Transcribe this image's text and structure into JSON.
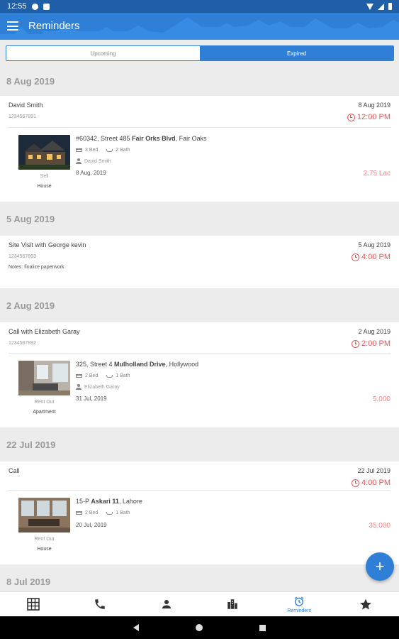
{
  "status_bar": {
    "time": "12:55"
  },
  "app_bar": {
    "title": "Reminders"
  },
  "tabs": [
    {
      "label": "Upcoming",
      "active": false
    },
    {
      "label": "Expired",
      "active": true
    }
  ],
  "groups": [
    {
      "date": "8 Aug 2019",
      "reminder": {
        "title": "David Smith",
        "phone": "1234567891",
        "date": "8 Aug 2019",
        "time": "12:00 PM",
        "property": {
          "address_prefix": "#60342, Street 485 ",
          "address_bold": "Fair Orks Blvd",
          "address_suffix": ", Fair Oaks",
          "beds": "3 Bed",
          "baths": "2 Bath",
          "owner": "David Smith",
          "date": "8 Aug, 2019",
          "price": "2.75 Lac",
          "type": "Sell",
          "category": "House"
        }
      }
    },
    {
      "date": "5 Aug 2019",
      "reminder": {
        "title": "Site Visit with George kevin",
        "phone": "1234567893",
        "notes": "Notes: finalize paperwork",
        "date": "5 Aug 2019",
        "time": "4:00 PM"
      }
    },
    {
      "date": "2 Aug 2019",
      "reminder": {
        "title": "Call with Elizabeth Garay",
        "phone": "1234567892",
        "date": "2 Aug 2019",
        "time": "2:00 PM",
        "property": {
          "address_prefix": "325, Street 4 ",
          "address_bold": "Mulholland Drive",
          "address_suffix": ", Hollywood",
          "beds": "2 Bed",
          "baths": "1 Bath",
          "owner": "Elizabeth Garay",
          "date": "31 Jul, 2019",
          "price": "5,000",
          "type": "Rent Out",
          "category": "Apartment"
        }
      }
    },
    {
      "date": "22 Jul 2019",
      "reminder": {
        "title": "Call",
        "date": "22 Jul 2019",
        "time": "4:00 PM",
        "property": {
          "address_prefix": "15-P ",
          "address_bold": "Askari 11",
          "address_suffix": ", Lahore",
          "beds": "2 Bed",
          "baths": "1 Bath",
          "date": "20 Jul, 2019",
          "price": "35,000",
          "type": "Rent Out",
          "category": "House"
        }
      }
    },
    {
      "date": "8 Jul 2019"
    }
  ],
  "fab": {
    "label": "+"
  },
  "bottom_nav": [
    {
      "icon": "grid-icon",
      "label": ""
    },
    {
      "icon": "phone-icon",
      "label": ""
    },
    {
      "icon": "person-icon",
      "label": ""
    },
    {
      "icon": "buildings-icon",
      "label": ""
    },
    {
      "icon": "alarm-icon",
      "label": "Reminders",
      "active": true
    },
    {
      "icon": "star-icon",
      "label": ""
    }
  ],
  "colors": {
    "primary": "#2f7fd6",
    "status_bar": "#1e5fa8",
    "alert": "#e05a5a",
    "price": "#f08a8a"
  }
}
